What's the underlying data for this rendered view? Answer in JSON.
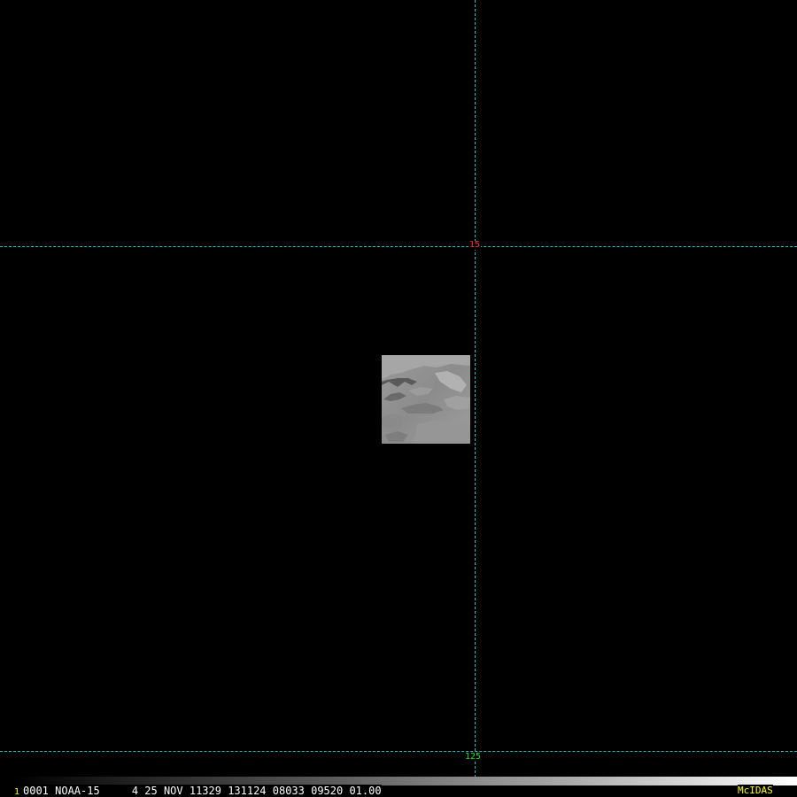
{
  "display": {
    "background": "#000000",
    "grid_color": "#1fbfbf"
  },
  "grid_labels": {
    "lat_label": "15",
    "lat_label_color": "#ff2a2a",
    "lon_label": "125",
    "lon_label_color": "#22dd22"
  },
  "image_tile": {
    "icon": "satellite-image-tile"
  },
  "status_bar": {
    "frame_number": "1",
    "frame_color": "#ffff00",
    "info_text": "0001 NOAA-15     4 25 NOV 11329 131124 08033 09520 01.00",
    "info_color": "#ffffff",
    "brand": "McIDAS",
    "brand_color": "#ffff00"
  }
}
